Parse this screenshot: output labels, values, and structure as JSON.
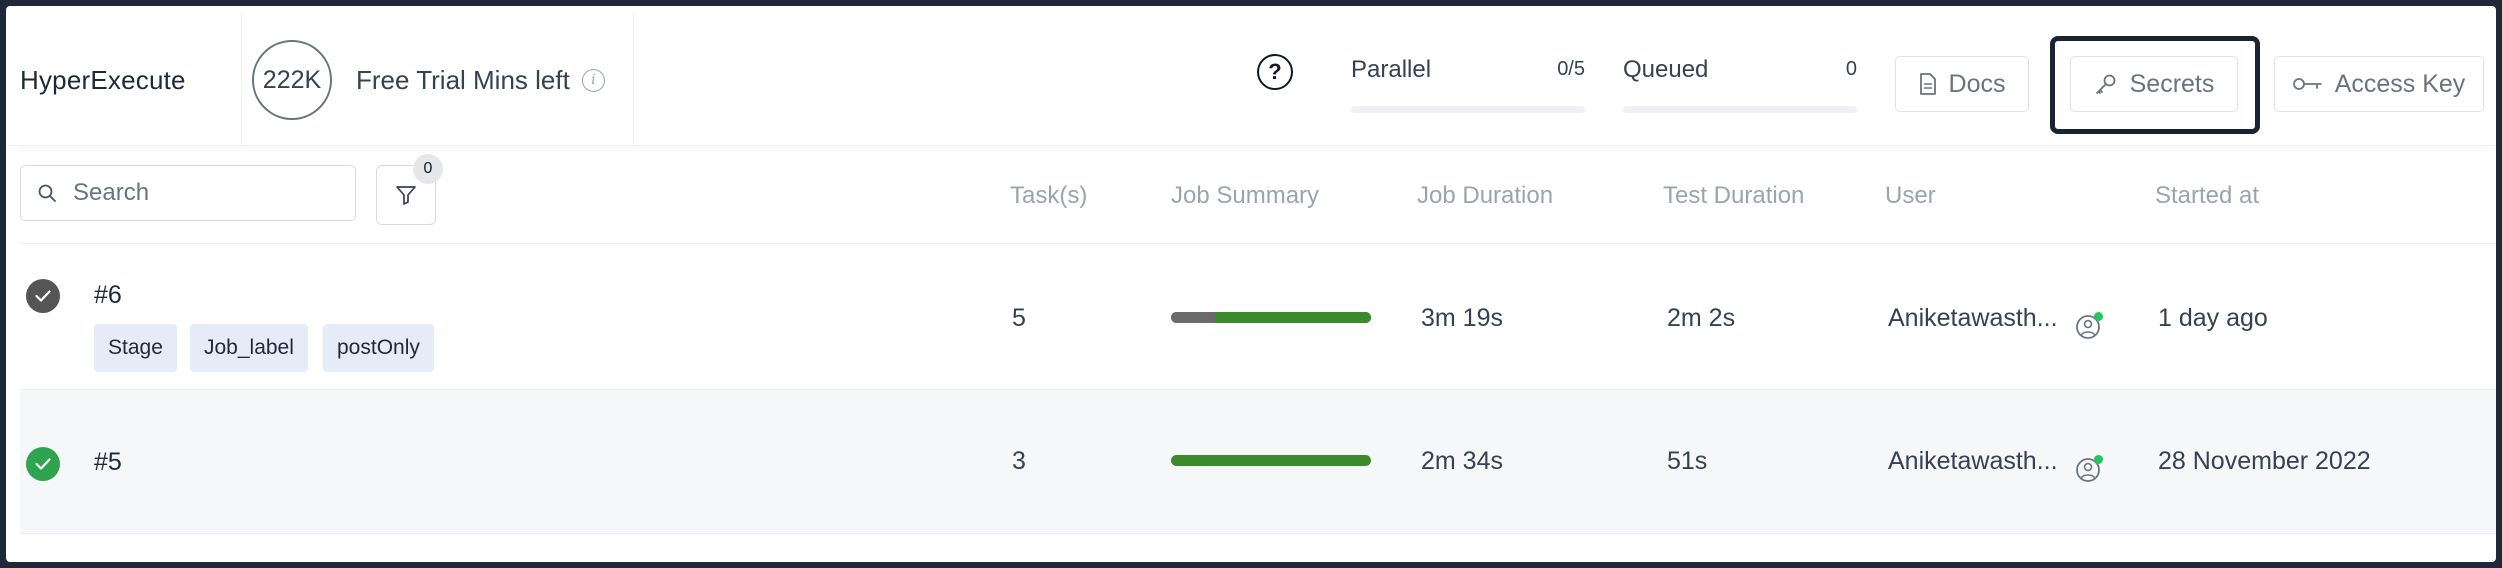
{
  "header": {
    "brand": "HyperExecute",
    "trial_minutes": "222K",
    "trial_label": "Free Trial Mins left",
    "parallel": {
      "label": "Parallel",
      "value": "0/5",
      "progress": 0
    },
    "queued": {
      "label": "Queued",
      "value": "0",
      "progress": 0
    },
    "docs_label": "Docs",
    "secrets_label": "Secrets",
    "access_key_label": "Access Key"
  },
  "toolbar": {
    "search_placeholder": "Search",
    "filter_count": "0"
  },
  "columns": [
    "Task(s)",
    "Job Summary",
    "Job Duration",
    "Test Duration",
    "User",
    "Started at"
  ],
  "jobs": [
    {
      "id": "#6",
      "status": "completed",
      "tags": [
        "Stage",
        "Job_label",
        "postOnly"
      ],
      "tasks": "5",
      "summary": {
        "grey_fraction": 0.22,
        "green_fraction": 0.78
      },
      "job_duration": "3m 19s",
      "test_duration": "2m 2s",
      "user": "Aniketawasth...",
      "started_at": "1 day ago"
    },
    {
      "id": "#5",
      "status": "passed",
      "tags": [],
      "tasks": "3",
      "summary": {
        "grey_fraction": 0,
        "green_fraction": 1
      },
      "job_duration": "2m 34s",
      "test_duration": "51s",
      "user": "Aniketawasth...",
      "started_at": "28 November 2022"
    }
  ],
  "colors": {
    "success": "#2ea44f",
    "completed": "#555555",
    "bar_green": "#3b8a2c",
    "bar_grey": "#6b6b6b",
    "online_dot": "#22c55e",
    "tag_bg": "#e5ecf7"
  },
  "icons": {
    "search": "search-icon",
    "filter": "filter-icon",
    "help": "help-icon",
    "info": "info-icon",
    "docs": "document-icon",
    "secrets": "wrench-key-icon",
    "access_key": "key-icon",
    "user": "user-avatar-icon",
    "check": "check-icon"
  }
}
